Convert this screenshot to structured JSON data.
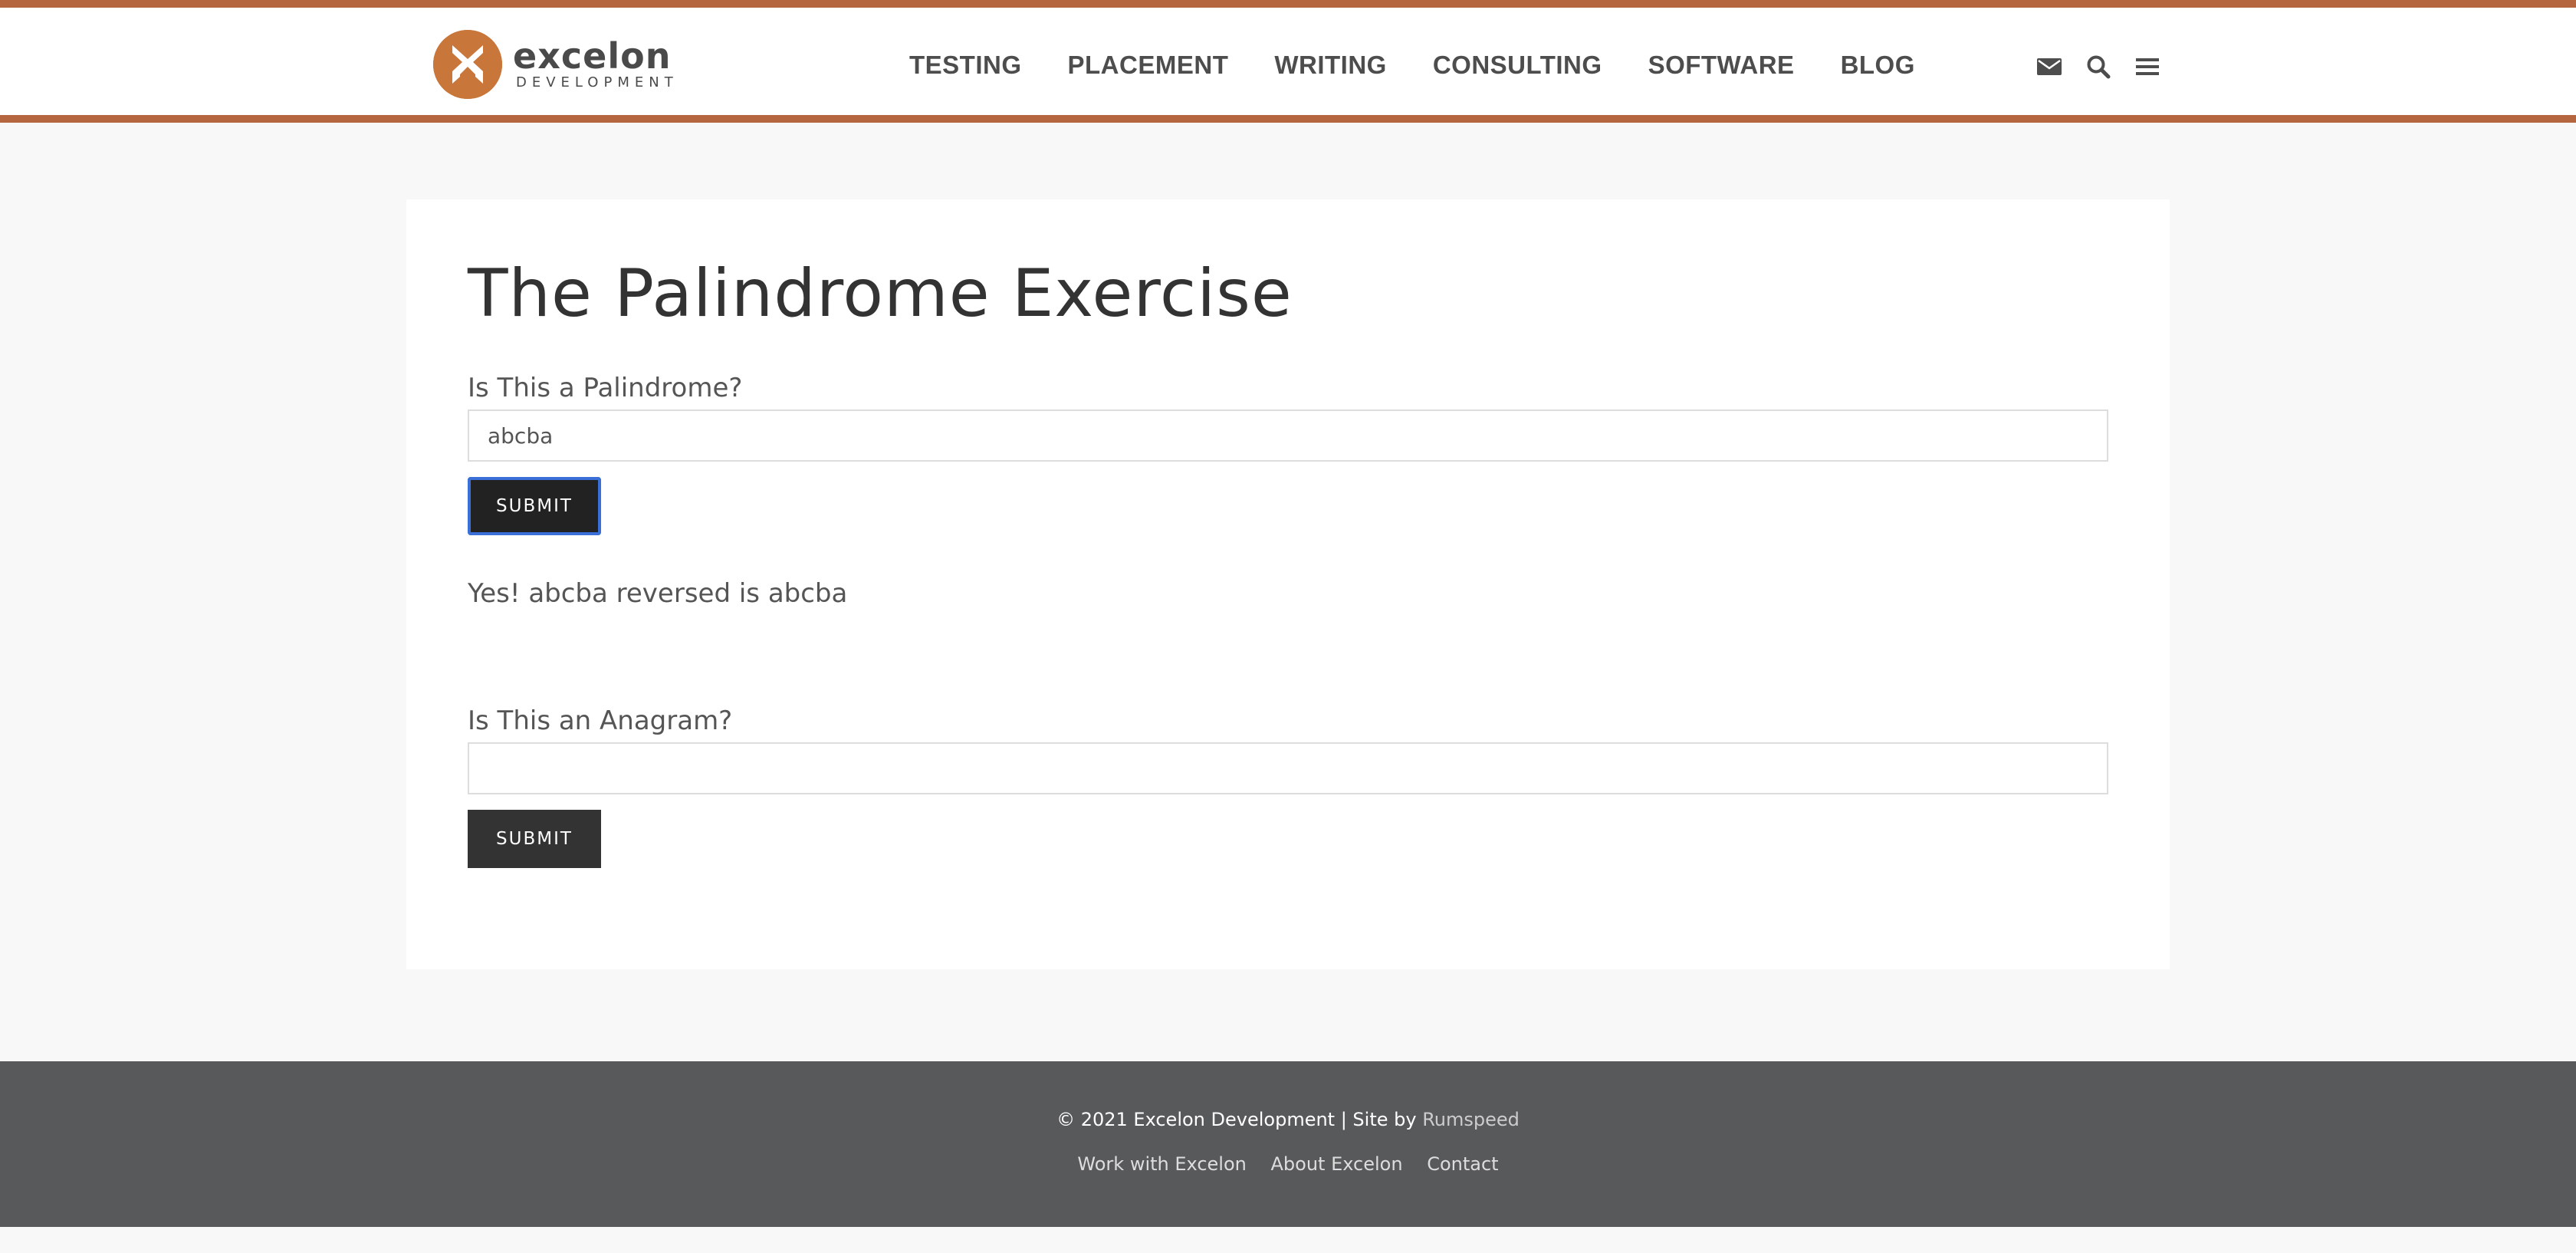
{
  "brand": {
    "name": "excelon",
    "tagline": "DEVELOPMENT",
    "accent_color": "#b5663e",
    "logo_color": "#c8763a"
  },
  "nav": {
    "items": [
      {
        "label": "TESTING"
      },
      {
        "label": "PLACEMENT"
      },
      {
        "label": "WRITING"
      },
      {
        "label": "CONSULTING"
      },
      {
        "label": "SOFTWARE"
      },
      {
        "label": "BLOG"
      }
    ],
    "icons": [
      "envelope-icon",
      "search-icon",
      "menu-icon"
    ]
  },
  "main": {
    "title": "The Palindrome Exercise",
    "palindrome": {
      "label": "Is This a Palindrome?",
      "input_value": "abcba",
      "submit_label": "SUBMIT",
      "result": "Yes! abcba reversed is abcba"
    },
    "anagram": {
      "label": "Is This an Anagram?",
      "input_value": "",
      "submit_label": "SUBMIT"
    }
  },
  "footer": {
    "copyright": "© 2021 Excelon Development | Site by",
    "credit_link": "Rumspeed",
    "links": [
      {
        "label": "Work with Excelon"
      },
      {
        "label": "About Excelon"
      },
      {
        "label": "Contact"
      }
    ],
    "background_color": "#58595b"
  }
}
